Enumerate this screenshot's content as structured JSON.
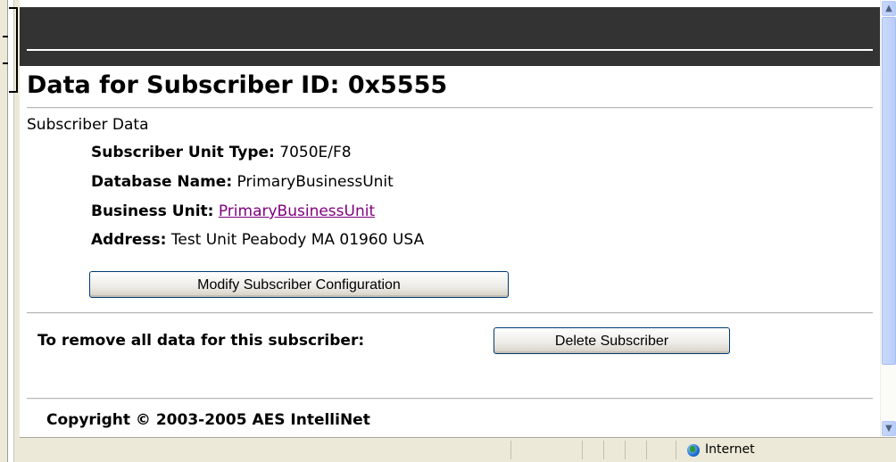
{
  "page": {
    "title": "Data for Subscriber ID: 0x5555",
    "section_label": "Subscriber Data"
  },
  "fields": [
    {
      "key": "Subscriber Unit Type:",
      "value": "7050E/F8"
    },
    {
      "key": "Database Name:",
      "value": "PrimaryBusinessUnit"
    },
    {
      "key": "Business Unit:",
      "value": "PrimaryBusinessUnit"
    },
    {
      "key": "Address:",
      "value": "Test Unit Peabody MA 01960 USA"
    }
  ],
  "actions": {
    "modify_label": "Modify Subscriber Configuration",
    "remove_prompt": "To remove all data for this subscriber:",
    "delete_label": "Delete Subscriber"
  },
  "footer": {
    "copyright": "Copyright © 2003-2005 AES IntelliNet"
  },
  "statusbar": {
    "zone_label": "Internet",
    "zone_icon": "globe-icon"
  },
  "scrollbar": {
    "up_icon": "chevron-up-icon",
    "down_icon": "chevron-down-icon"
  },
  "colors": {
    "header_bar": "#333333",
    "visited_link": "#800080",
    "button_border": "#003c74"
  }
}
